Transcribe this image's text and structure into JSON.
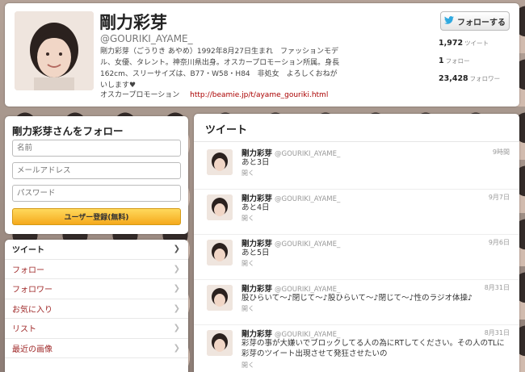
{
  "profile": {
    "name": "剛力彩芽",
    "handle": "@GOURIKI_AYAME_",
    "bio": "剛力彩芽（ごうりき あやめ）1992年8月27日生まれ　ファッションモデル、女優、タレント。神奈川県出身。オスカープロモーション所属。身長162cm、スリーサイズは、B77・W58・H84　非処女　よろしくおねがいします♥",
    "location": "オスカープロモーション",
    "url": "http://beamie.jp/t/ayame_gouriki.html",
    "follow_label": "フォローする",
    "stats": [
      {
        "value": "1,972",
        "label": "ツイート"
      },
      {
        "value": "1",
        "label": "フォロー"
      },
      {
        "value": "23,428",
        "label": "フォロワー"
      }
    ]
  },
  "signup": {
    "title": "剛力彩芽さんをフォロー",
    "name_placeholder": "名前",
    "email_placeholder": "メールアドレス",
    "password_placeholder": "パスワード",
    "register_label": "ユーザー登録(無料)"
  },
  "nav": {
    "items": [
      {
        "label": "ツイート"
      },
      {
        "label": "フォロー"
      },
      {
        "label": "フォロワー"
      },
      {
        "label": "お気に入り"
      },
      {
        "label": "リスト"
      },
      {
        "label": "最近の画像"
      }
    ]
  },
  "tweets": {
    "title": "ツイート",
    "items": [
      {
        "name": "剛力彩芽",
        "handle": "@GOURIKI_AYAME_",
        "time": "9時間",
        "text": "あと3日",
        "open": "開く"
      },
      {
        "name": "剛力彩芽",
        "handle": "@GOURIKI_AYAME_",
        "time": "9月7日",
        "text": "あと4日",
        "open": "開く"
      },
      {
        "name": "剛力彩芽",
        "handle": "@GOURIKI_AYAME_",
        "time": "9月6日",
        "text": "あと5日",
        "open": "開く"
      },
      {
        "name": "剛力彩芽",
        "handle": "@GOURIKI_AYAME_",
        "time": "8月31日",
        "text": "股ひらいて～♪閉じて～♪股ひらいて～♪閉じて～♪性のラジオ体操♪",
        "open": "開く"
      },
      {
        "name": "剛力彩芽",
        "handle": "@GOURIKI_AYAME_",
        "time": "8月31日",
        "text": "彩芽の事が大嫌いでブロックしてる人の為にRTしてください。その人のTLに彩芽のツイート出現させて発狂させたいの",
        "open": "開く"
      }
    ]
  },
  "colors": {
    "accent_link": "#a02a2a",
    "register_button": "#f5a91c",
    "twitter_bird": "#2fa9e0"
  }
}
